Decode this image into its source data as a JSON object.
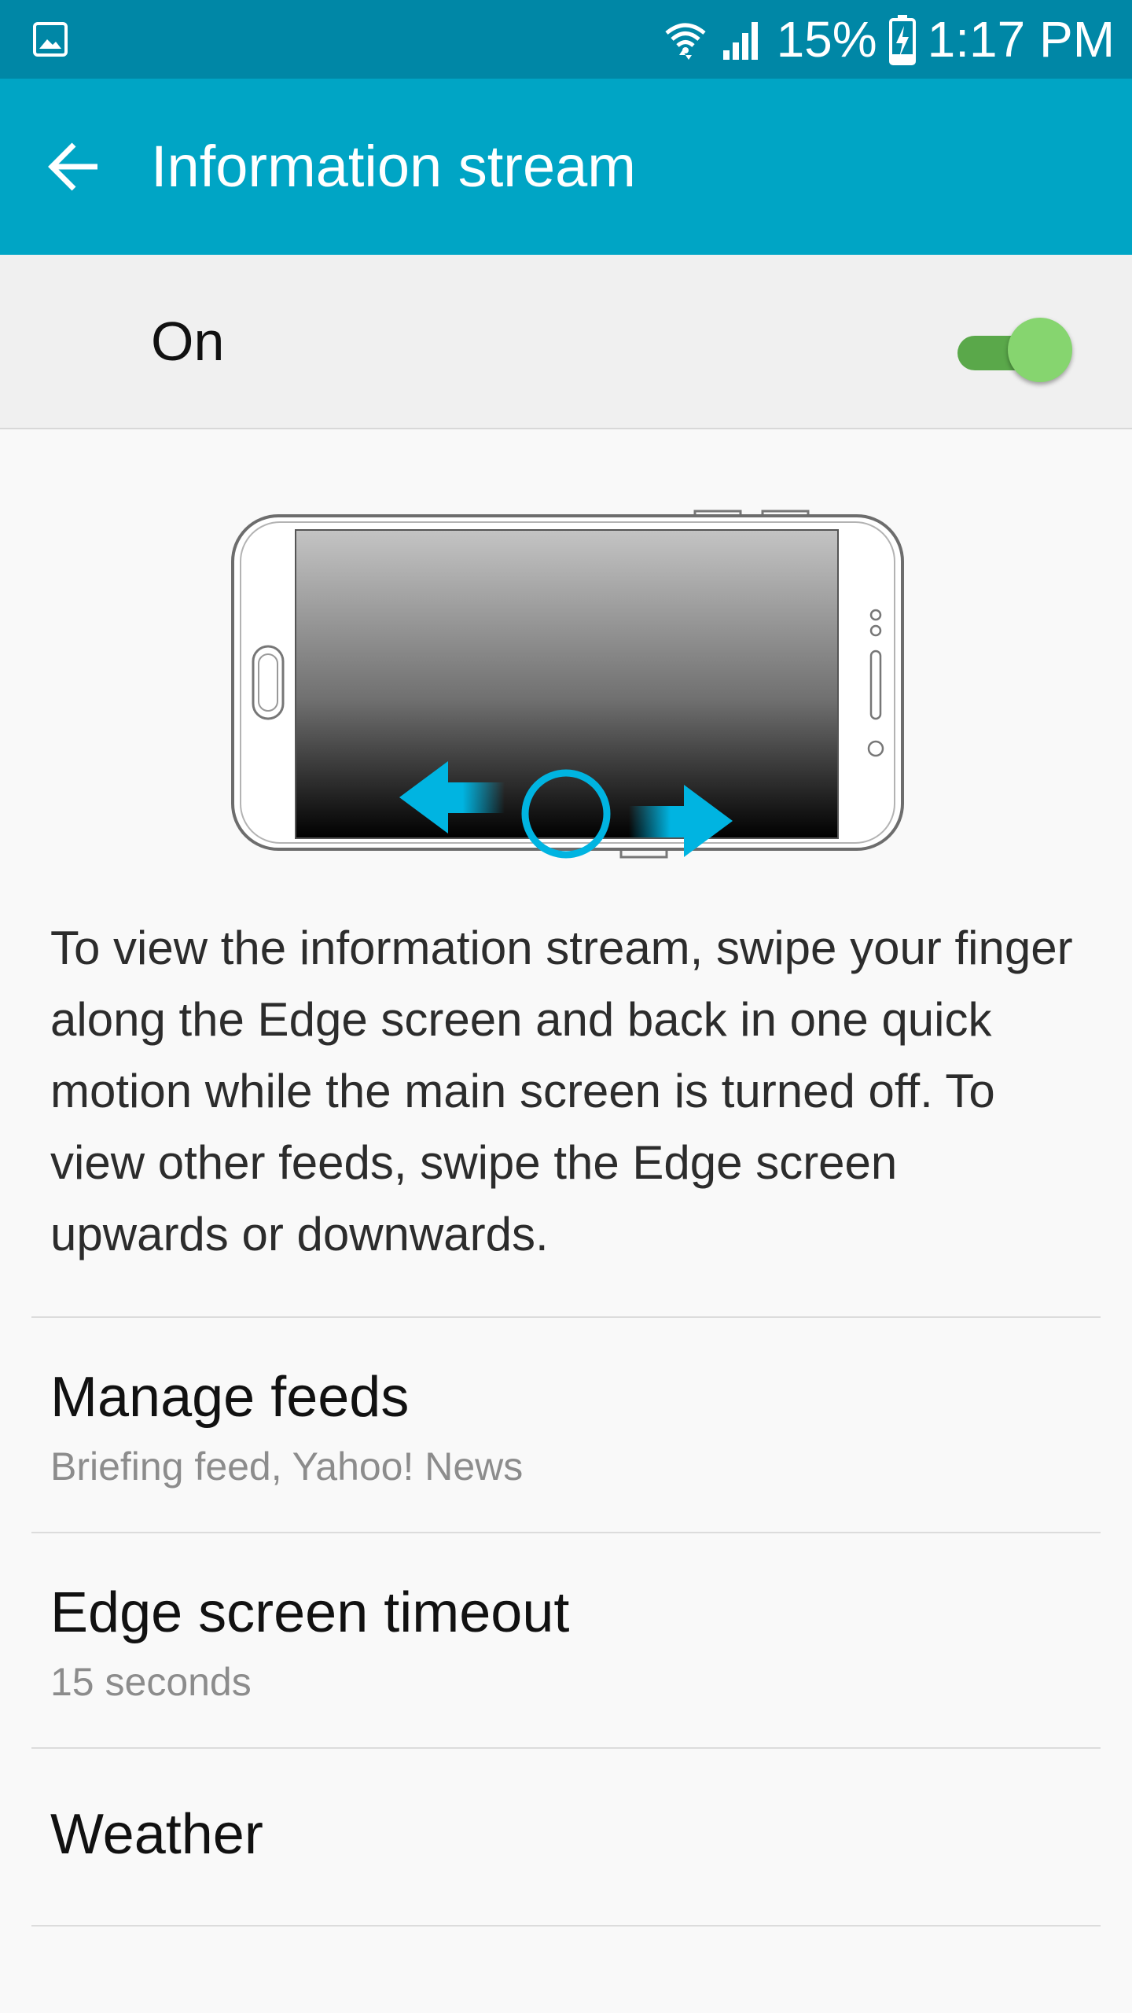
{
  "status_bar": {
    "battery": "15%",
    "time": "1:17 PM",
    "icons": [
      "gallery-icon",
      "wifi-icon",
      "signal-icon",
      "battery-charging-icon"
    ]
  },
  "app_bar": {
    "title": "Information stream",
    "back_icon": "arrow-left-icon"
  },
  "master_switch": {
    "label": "On",
    "checked": true
  },
  "illustration": {
    "description_icon": "phone-edge-swipe-illustration"
  },
  "description": "To view the information stream, swipe your finger along the Edge screen and back in one quick motion while the main screen is turned off. To view other feeds, swipe the Edge screen upwards or downwards.",
  "settings": [
    {
      "title": "Manage feeds",
      "subtitle": "Briefing feed, Yahoo! News"
    },
    {
      "title": "Edge screen timeout",
      "subtitle": "15 seconds"
    },
    {
      "title": "Weather",
      "subtitle": ""
    }
  ],
  "colors": {
    "status_bar": "#0087a6",
    "app_bar": "#00a5c5",
    "switch_on": "#86d56f",
    "accent_arrow": "#00b4e1"
  }
}
